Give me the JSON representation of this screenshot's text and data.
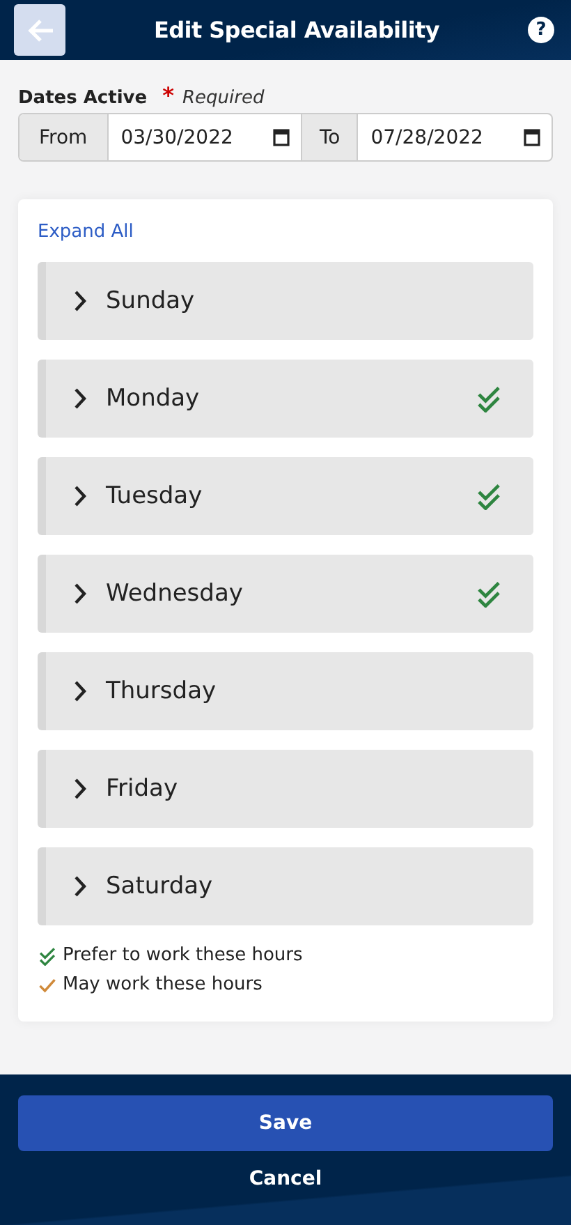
{
  "header": {
    "title": "Edit Special Availability",
    "help": "?"
  },
  "dates": {
    "label": "Dates Active",
    "required_mark": "*",
    "required_text": "Required",
    "fields": [
      {
        "addon": "From",
        "value": "03/30/2022"
      },
      {
        "addon": "To",
        "value": "07/28/2022"
      }
    ]
  },
  "expand_all": "Expand All",
  "days": [
    {
      "name": "Sunday",
      "preferred": false
    },
    {
      "name": "Monday",
      "preferred": true
    },
    {
      "name": "Tuesday",
      "preferred": true
    },
    {
      "name": "Wednesday",
      "preferred": true
    },
    {
      "name": "Thursday",
      "preferred": false
    },
    {
      "name": "Friday",
      "preferred": false
    },
    {
      "name": "Saturday",
      "preferred": false
    }
  ],
  "legend": [
    {
      "kind": "preferred",
      "text": "Prefer to work these hours"
    },
    {
      "kind": "may",
      "text": "May work these hours"
    }
  ],
  "buttons": {
    "save": "Save",
    "cancel": "Cancel"
  }
}
